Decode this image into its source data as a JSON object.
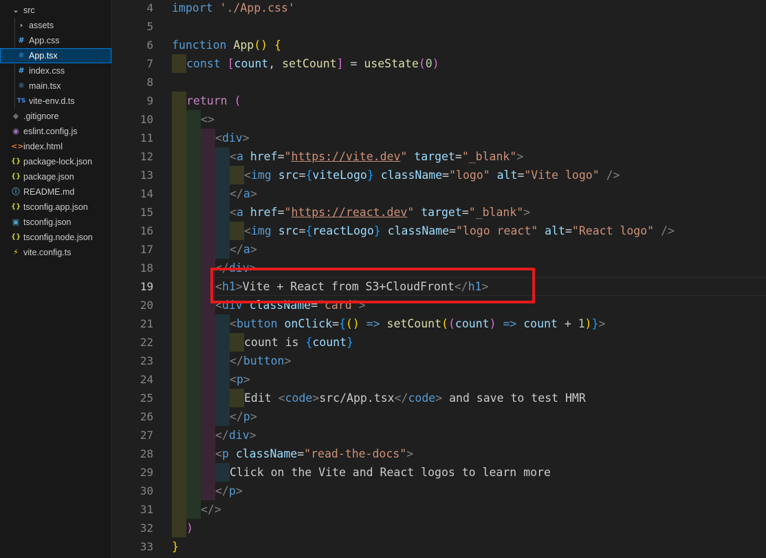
{
  "explorer": {
    "items": [
      {
        "label": "src",
        "icon": "chevron-down-icon",
        "glyph": "⌄",
        "color": "#cccccc",
        "indent": 20,
        "folder": true
      },
      {
        "label": "assets",
        "icon": "chevron-right-icon",
        "glyph": "›",
        "color": "#cccccc",
        "indent": 28,
        "folder": true
      },
      {
        "label": "App.css",
        "icon": "css-file-icon",
        "glyph": "#",
        "color": "#42a5f5",
        "indent": 28
      },
      {
        "label": "App.tsx",
        "icon": "react-file-icon",
        "glyph": "⚛",
        "color": "#4fc1ff",
        "indent": 28,
        "selected": true
      },
      {
        "label": "index.css",
        "icon": "css-file-icon",
        "glyph": "#",
        "color": "#42a5f5",
        "indent": 28
      },
      {
        "label": "main.tsx",
        "icon": "react-file-icon",
        "glyph": "⚛",
        "color": "#4fc1ff",
        "indent": 28
      },
      {
        "label": "vite-env.d.ts",
        "icon": "typescript-file-icon",
        "glyph": "TS",
        "color": "#3b8eea",
        "indent": 28
      },
      {
        "label": ".gitignore",
        "icon": "git-file-icon",
        "glyph": "◆",
        "color": "#6b6b6b",
        "indent": 20
      },
      {
        "label": "eslint.config.js",
        "icon": "eslint-file-icon",
        "glyph": "◉",
        "color": "#a074c4",
        "indent": 20
      },
      {
        "label": "index.html",
        "icon": "html-file-icon",
        "glyph": "<>",
        "color": "#e37933",
        "indent": 20
      },
      {
        "label": "package-lock.json",
        "icon": "json-file-icon",
        "glyph": "{}",
        "color": "#cbcb41",
        "indent": 20
      },
      {
        "label": "package.json",
        "icon": "json-file-icon",
        "glyph": "{}",
        "color": "#cbcb41",
        "indent": 20
      },
      {
        "label": "README.md",
        "icon": "info-file-icon",
        "glyph": "ⓘ",
        "color": "#519aba",
        "indent": 20
      },
      {
        "label": "tsconfig.app.json",
        "icon": "json-file-icon",
        "glyph": "{}",
        "color": "#cbcb41",
        "indent": 20
      },
      {
        "label": "tsconfig.json",
        "icon": "tsconfig-file-icon",
        "glyph": "▣",
        "color": "#519aba",
        "indent": 20
      },
      {
        "label": "tsconfig.node.json",
        "icon": "json-file-icon",
        "glyph": "{}",
        "color": "#cbcb41",
        "indent": 20
      },
      {
        "label": "vite.config.ts",
        "icon": "vite-file-icon",
        "glyph": "⚡",
        "color": "#ffd62e",
        "indent": 20
      }
    ]
  },
  "editor": {
    "file": "App.tsx",
    "active_line": 19,
    "highlighted_text": "<h1>Vite + React from S3+CloudFront</h1>",
    "lines": [
      {
        "n": 4,
        "indent": 0,
        "tokens": [
          [
            "kw",
            "import "
          ],
          [
            "str",
            "'./App.css'"
          ]
        ]
      },
      {
        "n": 5,
        "indent": 0,
        "tokens": []
      },
      {
        "n": 6,
        "indent": 0,
        "tokens": [
          [
            "kw",
            "function "
          ],
          [
            "fn",
            "App"
          ],
          [
            "br1",
            "() {"
          ]
        ]
      },
      {
        "n": 7,
        "indent": 1,
        "tokens": [
          [
            "kw",
            "const "
          ],
          [
            "br2",
            "["
          ],
          [
            "var",
            "count"
          ],
          [
            "txt",
            ", "
          ],
          [
            "fn",
            "setCount"
          ],
          [
            "br2",
            "]"
          ],
          [
            "txt",
            " = "
          ],
          [
            "fn",
            "useState"
          ],
          [
            "br2",
            "("
          ],
          [
            "num",
            "0"
          ],
          [
            "br2",
            ")"
          ]
        ]
      },
      {
        "n": 8,
        "indent": 0,
        "tokens": []
      },
      {
        "n": 9,
        "indent": 1,
        "tokens": [
          [
            "ctl",
            "return "
          ],
          [
            "br2",
            "("
          ]
        ]
      },
      {
        "n": 10,
        "indent": 2,
        "tokens": [
          [
            "pun",
            "<>"
          ]
        ]
      },
      {
        "n": 11,
        "indent": 3,
        "tokens": [
          [
            "pun",
            "<"
          ],
          [
            "tag",
            "div"
          ],
          [
            "pun",
            ">"
          ]
        ]
      },
      {
        "n": 12,
        "indent": 4,
        "tokens": [
          [
            "pun",
            "<"
          ],
          [
            "tag",
            "a "
          ],
          [
            "attr",
            "href"
          ],
          [
            "txt",
            "="
          ],
          [
            "str",
            "\""
          ],
          [
            "strlink",
            "https://vite.dev"
          ],
          [
            "str",
            "\""
          ],
          [
            "attr",
            " target"
          ],
          [
            "txt",
            "="
          ],
          [
            "str",
            "\"_blank\""
          ],
          [
            "pun",
            ">"
          ]
        ]
      },
      {
        "n": 13,
        "indent": 5,
        "tokens": [
          [
            "pun",
            "<"
          ],
          [
            "tag",
            "img "
          ],
          [
            "attr",
            "src"
          ],
          [
            "txt",
            "="
          ],
          [
            "br3",
            "{"
          ],
          [
            "var",
            "viteLogo"
          ],
          [
            "br3",
            "}"
          ],
          [
            "attr",
            " className"
          ],
          [
            "txt",
            "="
          ],
          [
            "str",
            "\"logo\""
          ],
          [
            "attr",
            " alt"
          ],
          [
            "txt",
            "="
          ],
          [
            "str",
            "\"Vite logo\""
          ],
          [
            "pun",
            " />"
          ]
        ]
      },
      {
        "n": 14,
        "indent": 4,
        "tokens": [
          [
            "pun",
            "</"
          ],
          [
            "tag",
            "a"
          ],
          [
            "pun",
            ">"
          ]
        ]
      },
      {
        "n": 15,
        "indent": 4,
        "tokens": [
          [
            "pun",
            "<"
          ],
          [
            "tag",
            "a "
          ],
          [
            "attr",
            "href"
          ],
          [
            "txt",
            "="
          ],
          [
            "str",
            "\""
          ],
          [
            "strlink",
            "https://react.dev"
          ],
          [
            "str",
            "\""
          ],
          [
            "attr",
            " target"
          ],
          [
            "txt",
            "="
          ],
          [
            "str",
            "\"_blank\""
          ],
          [
            "pun",
            ">"
          ]
        ]
      },
      {
        "n": 16,
        "indent": 5,
        "tokens": [
          [
            "pun",
            "<"
          ],
          [
            "tag",
            "img "
          ],
          [
            "attr",
            "src"
          ],
          [
            "txt",
            "="
          ],
          [
            "br3",
            "{"
          ],
          [
            "var",
            "reactLogo"
          ],
          [
            "br3",
            "}"
          ],
          [
            "attr",
            " className"
          ],
          [
            "txt",
            "="
          ],
          [
            "str",
            "\"logo react\""
          ],
          [
            "attr",
            " alt"
          ],
          [
            "txt",
            "="
          ],
          [
            "str",
            "\"React logo\""
          ],
          [
            "pun",
            " />"
          ]
        ]
      },
      {
        "n": 17,
        "indent": 4,
        "tokens": [
          [
            "pun",
            "</"
          ],
          [
            "tag",
            "a"
          ],
          [
            "pun",
            ">"
          ]
        ]
      },
      {
        "n": 18,
        "indent": 3,
        "tokens": [
          [
            "pun",
            "</"
          ],
          [
            "tag",
            "div"
          ],
          [
            "pun",
            ">"
          ]
        ]
      },
      {
        "n": 19,
        "indent": 3,
        "tokens": [
          [
            "pun",
            "<"
          ],
          [
            "tag",
            "h1"
          ],
          [
            "pun",
            ">"
          ],
          [
            "txt",
            "Vite + React from S3+CloudFront"
          ],
          [
            "pun",
            "</"
          ],
          [
            "tag",
            "h1"
          ],
          [
            "pun",
            ">"
          ]
        ]
      },
      {
        "n": 20,
        "indent": 3,
        "tokens": [
          [
            "pun",
            "<"
          ],
          [
            "tag",
            "div "
          ],
          [
            "attr",
            "className"
          ],
          [
            "txt",
            "="
          ],
          [
            "str",
            "\"card\""
          ],
          [
            "pun",
            ">"
          ]
        ]
      },
      {
        "n": 21,
        "indent": 4,
        "tokens": [
          [
            "pun",
            "<"
          ],
          [
            "tag",
            "button "
          ],
          [
            "attr",
            "onClick"
          ],
          [
            "txt",
            "="
          ],
          [
            "br3",
            "{"
          ],
          [
            "br1",
            "() "
          ],
          [
            "kw",
            "=> "
          ],
          [
            "fn",
            "setCount"
          ],
          [
            "br1",
            "("
          ],
          [
            "br2",
            "("
          ],
          [
            "var",
            "count"
          ],
          [
            "br2",
            ") "
          ],
          [
            "kw",
            "=> "
          ],
          [
            "var",
            "count"
          ],
          [
            "txt",
            " + "
          ],
          [
            "num",
            "1"
          ],
          [
            "br1",
            ")"
          ],
          [
            "br3",
            "}"
          ],
          [
            "pun",
            ">"
          ]
        ]
      },
      {
        "n": 22,
        "indent": 5,
        "tokens": [
          [
            "txt",
            "count is "
          ],
          [
            "br3",
            "{"
          ],
          [
            "var",
            "count"
          ],
          [
            "br3",
            "}"
          ]
        ]
      },
      {
        "n": 23,
        "indent": 4,
        "tokens": [
          [
            "pun",
            "</"
          ],
          [
            "tag",
            "button"
          ],
          [
            "pun",
            ">"
          ]
        ]
      },
      {
        "n": 24,
        "indent": 4,
        "tokens": [
          [
            "pun",
            "<"
          ],
          [
            "tag",
            "p"
          ],
          [
            "pun",
            ">"
          ]
        ]
      },
      {
        "n": 25,
        "indent": 5,
        "tokens": [
          [
            "txt",
            "Edit "
          ],
          [
            "pun",
            "<"
          ],
          [
            "tag",
            "code"
          ],
          [
            "pun",
            ">"
          ],
          [
            "txt",
            "src/App.tsx"
          ],
          [
            "pun",
            "</"
          ],
          [
            "tag",
            "code"
          ],
          [
            "pun",
            ">"
          ],
          [
            "txt",
            " and save to test HMR"
          ]
        ]
      },
      {
        "n": 26,
        "indent": 4,
        "tokens": [
          [
            "pun",
            "</"
          ],
          [
            "tag",
            "p"
          ],
          [
            "pun",
            ">"
          ]
        ]
      },
      {
        "n": 27,
        "indent": 3,
        "tokens": [
          [
            "pun",
            "</"
          ],
          [
            "tag",
            "div"
          ],
          [
            "pun",
            ">"
          ]
        ]
      },
      {
        "n": 28,
        "indent": 3,
        "tokens": [
          [
            "pun",
            "<"
          ],
          [
            "tag",
            "p "
          ],
          [
            "attr",
            "className"
          ],
          [
            "txt",
            "="
          ],
          [
            "str",
            "\"read-the-docs\""
          ],
          [
            "pun",
            ">"
          ]
        ]
      },
      {
        "n": 29,
        "indent": 4,
        "tokens": [
          [
            "txt",
            "Click on the Vite and React logos to learn more"
          ]
        ]
      },
      {
        "n": 30,
        "indent": 3,
        "tokens": [
          [
            "pun",
            "</"
          ],
          [
            "tag",
            "p"
          ],
          [
            "pun",
            ">"
          ]
        ]
      },
      {
        "n": 31,
        "indent": 2,
        "tokens": [
          [
            "pun",
            "</>"
          ]
        ]
      },
      {
        "n": 32,
        "indent": 1,
        "tokens": [
          [
            "br2",
            ")"
          ]
        ]
      },
      {
        "n": 33,
        "indent": 0,
        "tokens": [
          [
            "br1",
            "}"
          ]
        ]
      }
    ]
  },
  "colors": {
    "indent_bands": [
      "#3a3a22",
      "#263526",
      "#3a2535",
      "#20333a",
      "#3a3a22"
    ],
    "highlight_box": "#e31b1b"
  }
}
